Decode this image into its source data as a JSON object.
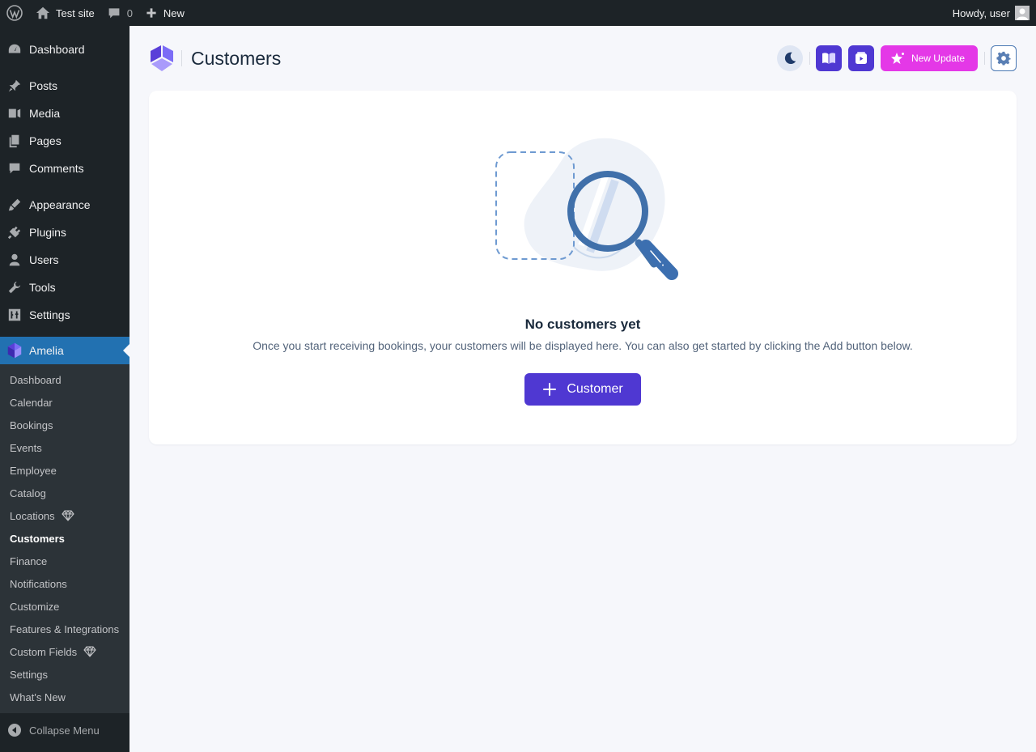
{
  "adminbar": {
    "site_name": "Test site",
    "comments_count": "0",
    "new_label": "New",
    "howdy": "Howdy, user"
  },
  "sidebar": {
    "items": [
      {
        "label": "Dashboard",
        "icon": "dashboard-icon"
      },
      {
        "label": "Posts",
        "icon": "pin-icon"
      },
      {
        "label": "Media",
        "icon": "media-icon"
      },
      {
        "label": "Pages",
        "icon": "pages-icon"
      },
      {
        "label": "Comments",
        "icon": "comment-icon"
      },
      {
        "label": "Appearance",
        "icon": "brush-icon"
      },
      {
        "label": "Plugins",
        "icon": "plug-icon"
      },
      {
        "label": "Users",
        "icon": "user-icon"
      },
      {
        "label": "Tools",
        "icon": "wrench-icon"
      },
      {
        "label": "Settings",
        "icon": "settings-icon"
      },
      {
        "label": "Amelia",
        "icon": "amelia-logo-icon"
      }
    ],
    "submenu": [
      {
        "label": "Dashboard"
      },
      {
        "label": "Calendar"
      },
      {
        "label": "Bookings"
      },
      {
        "label": "Events"
      },
      {
        "label": "Employee"
      },
      {
        "label": "Catalog"
      },
      {
        "label": "Locations",
        "premium": true
      },
      {
        "label": "Customers",
        "current": true
      },
      {
        "label": "Finance"
      },
      {
        "label": "Notifications"
      },
      {
        "label": "Customize"
      },
      {
        "label": "Features & Integrations"
      },
      {
        "label": "Custom Fields",
        "premium": true
      },
      {
        "label": "Settings"
      },
      {
        "label": "What's New"
      }
    ],
    "collapse_label": "Collapse Menu"
  },
  "header": {
    "title": "Customers",
    "update_label": "New Update",
    "icons": [
      "moon-icon",
      "book-icon",
      "video-icon",
      "sparkle-icon",
      "gear-icon"
    ]
  },
  "empty_state": {
    "title": "No customers yet",
    "description": "Once you start receiving bookings, your customers will be displayed here. You can also get started by clicking the Add button below.",
    "button_label": "Customer"
  },
  "colors": {
    "accent": "#4f38d2",
    "update": "#e438e7",
    "wp_active": "#2271b1",
    "wp_dark": "#1d2327"
  }
}
